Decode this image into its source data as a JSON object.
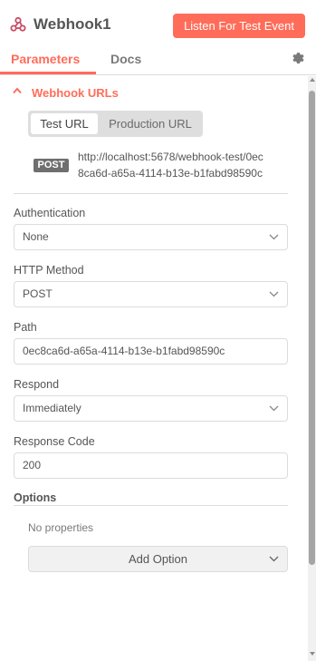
{
  "header": {
    "node_title": "Webhook1",
    "listen_button": "Listen For Test Event",
    "node_icon": "webhook-icon"
  },
  "tabs": {
    "parameters": "Parameters",
    "docs": "Docs",
    "settings_icon": "gear-icon"
  },
  "webhook_urls": {
    "section_title": "Webhook URLs",
    "toggle": {
      "test": "Test URL",
      "production": "Production URL",
      "selected": "Test URL"
    },
    "method": "POST",
    "url_line1": "http://localhost:5678/webhook-test/0ec",
    "url_line2": "8ca6d-a65a-4114-b13e-b1fabd98590c"
  },
  "fields": {
    "authentication": {
      "label": "Authentication",
      "value": "None"
    },
    "http_method": {
      "label": "HTTP Method",
      "value": "POST"
    },
    "path": {
      "label": "Path",
      "value": "0ec8ca6d-a65a-4114-b13e-b1fabd98590c"
    },
    "respond": {
      "label": "Respond",
      "value": "Immediately"
    },
    "response_code": {
      "label": "Response Code",
      "value": "200"
    }
  },
  "options": {
    "label": "Options",
    "empty_text": "No properties",
    "add_button": "Add Option"
  },
  "colors": {
    "accent": "#ff6d5a",
    "badge": "#6f6f6f",
    "border": "#dcdcdc"
  }
}
